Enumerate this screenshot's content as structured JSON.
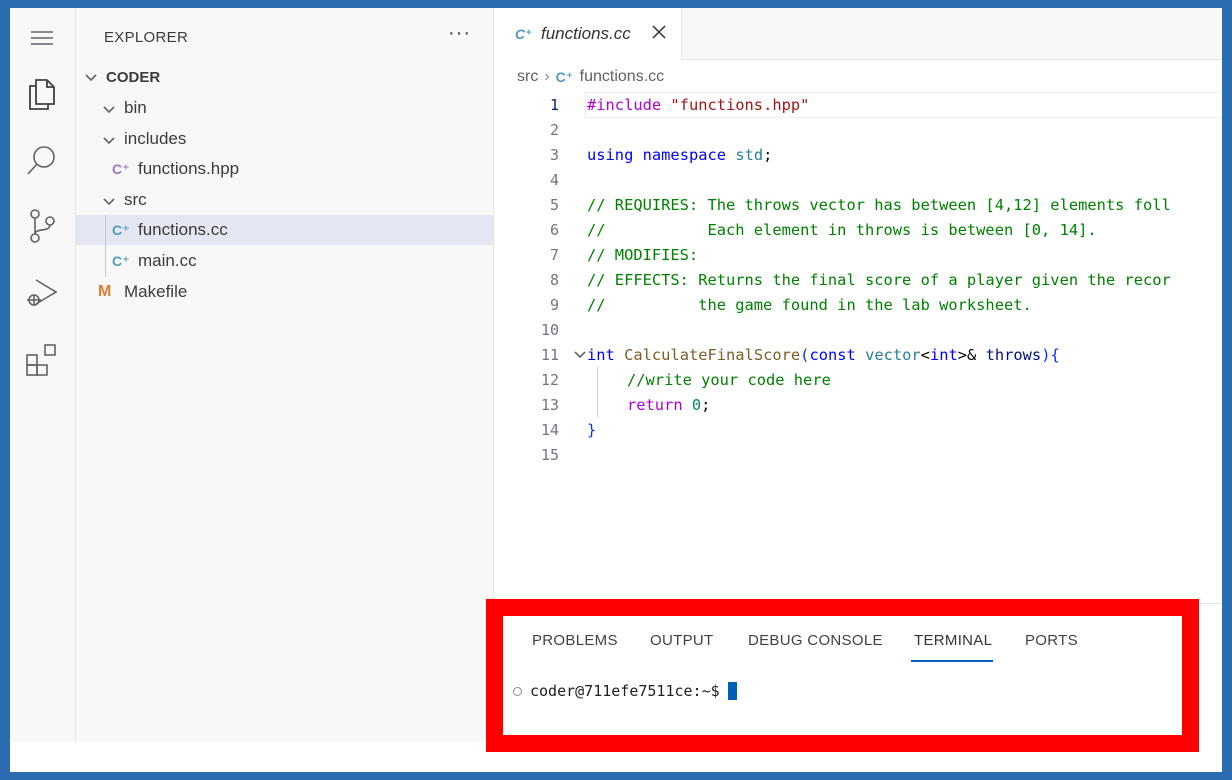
{
  "explorer": {
    "title": "EXPLORER",
    "more": "···",
    "root": "CODER",
    "items": [
      {
        "label": "bin",
        "kind": "folder"
      },
      {
        "label": "includes",
        "kind": "folder"
      },
      {
        "label": "functions.hpp",
        "kind": "hpp"
      },
      {
        "label": "src",
        "kind": "folder"
      },
      {
        "label": "functions.cc",
        "kind": "cc"
      },
      {
        "label": "main.cc",
        "kind": "cc"
      },
      {
        "label": "Makefile",
        "kind": "make"
      }
    ]
  },
  "editor": {
    "tab_label": "functions.cc",
    "breadcrumb": [
      "src",
      "functions.cc"
    ],
    "line_numbers": [
      "1",
      "2",
      "3",
      "4",
      "5",
      "6",
      "7",
      "8",
      "9",
      "10",
      "11",
      "12",
      "13",
      "14",
      "15"
    ],
    "lines": {
      "l1_dir": "#include ",
      "l1_str": "\"functions.hpp\"",
      "l3_kw1": "using",
      "l3_kw2": "namespace",
      "l3_ns": "std",
      "l3_end": ";",
      "l5": "// REQUIRES: The throws vector has between [4,12] elements foll",
      "l6": "//           Each element in throws is between [0, 14].",
      "l7": "// MODIFIES:",
      "l8": "// EFFECTS: Returns the final score of a player given the recor",
      "l9": "//          the game found in the lab worksheet.",
      "l11_int": "int",
      "l11_fn": "CalculateFinalScore",
      "l11_open": "(",
      "l11_const": "const",
      "l11_vec": "vector",
      "l11_lt": "<",
      "l11_int2": "int",
      "l11_gt": ">&",
      "l11_param": "throws",
      "l11_close": "){",
      "l12": "//write your code here",
      "l13_kw": "return",
      "l13_num": "0",
      "l13_end": ";",
      "l14": "}"
    }
  },
  "panel": {
    "tabs": [
      "PROBLEMS",
      "OUTPUT",
      "DEBUG CONSOLE",
      "TERMINAL",
      "PORTS"
    ],
    "active_tab": "TERMINAL",
    "prompt": "coder@711efe7511ce:~$"
  },
  "colors": {
    "frame": "#2b6cb0",
    "highlight": "#ff0000",
    "accent": "#005fb8"
  }
}
